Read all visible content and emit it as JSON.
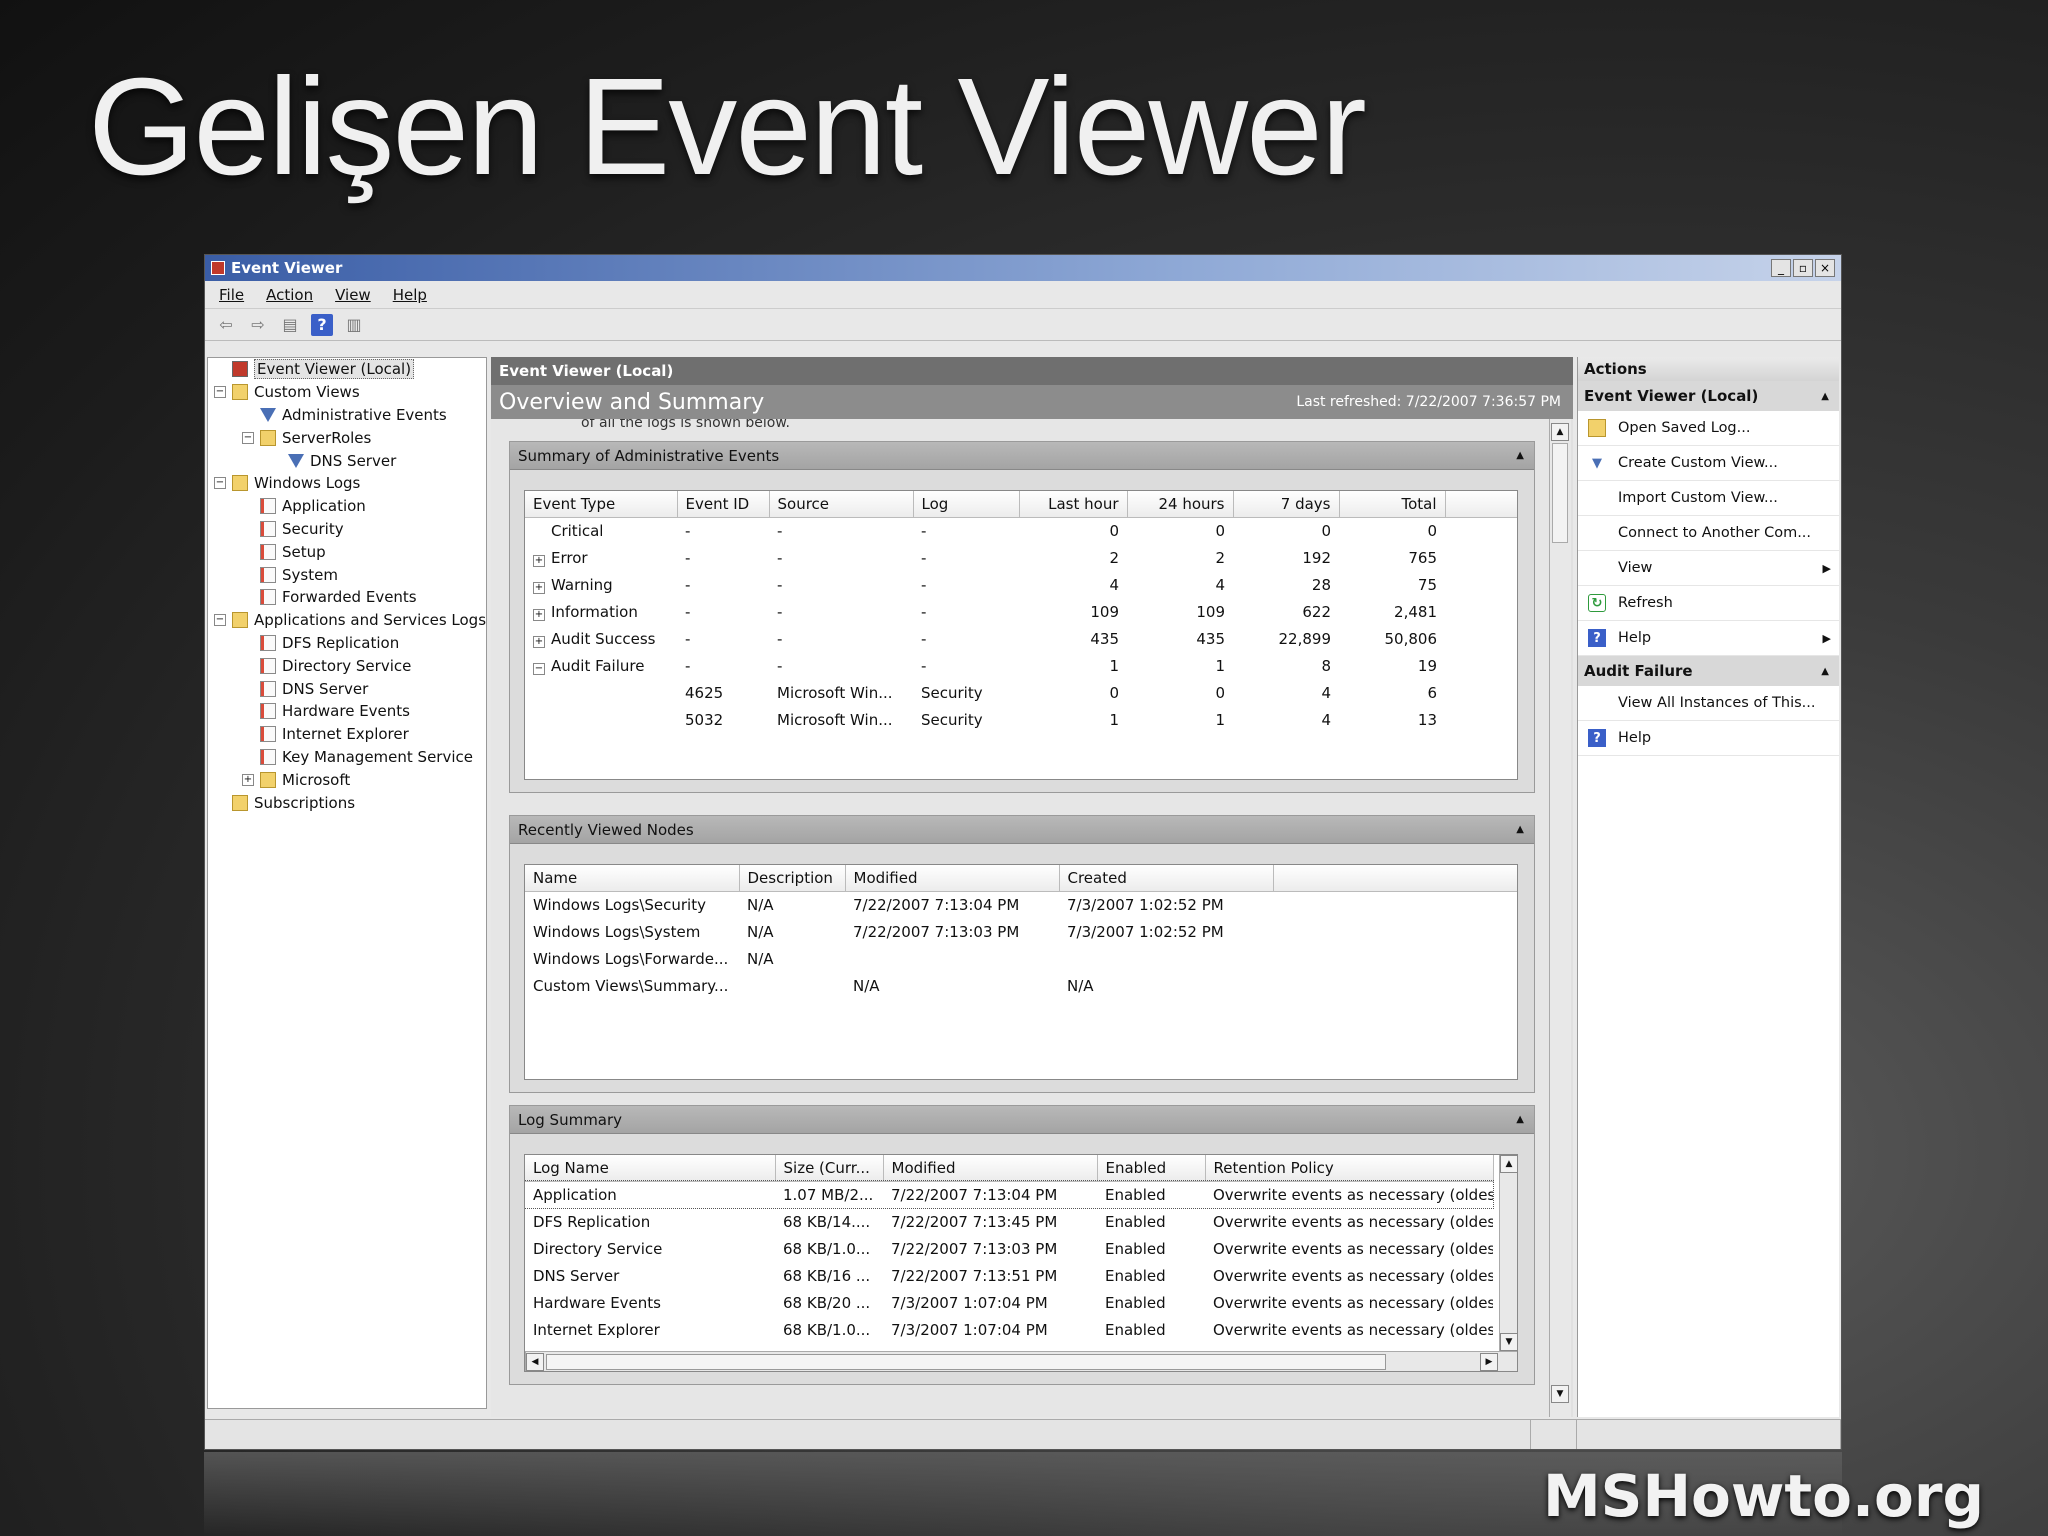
{
  "slide": {
    "title": "Gelişen Event Viewer",
    "brand": "MSHowto.org"
  },
  "window": {
    "title": "Event Viewer",
    "min": "_",
    "max": "▫",
    "close": "×"
  },
  "menu": {
    "file": "File",
    "action": "Action",
    "view": "View",
    "help": "Help"
  },
  "tree": {
    "root": "Event Viewer (Local)",
    "custom_views": "Custom Views",
    "admin_events": "Administrative Events",
    "server_roles": "ServerRoles",
    "dns_server_view": "DNS Server",
    "windows_logs": "Windows Logs",
    "application": "Application",
    "security": "Security",
    "setup": "Setup",
    "system": "System",
    "forwarded": "Forwarded Events",
    "apps_services": "Applications and Services Logs",
    "dfs": "DFS Replication",
    "directory": "Directory Service",
    "dns": "DNS Server",
    "hardware": "Hardware Events",
    "ie": "Internet Explorer",
    "kms": "Key Management Service",
    "microsoft": "Microsoft",
    "subscriptions": "Subscriptions"
  },
  "center": {
    "header": "Event Viewer (Local)",
    "overview_title": "Overview and Summary",
    "last_refreshed": "Last refreshed: 7/22/2007 7:36:57 PM",
    "cut_text": "of all the logs is shown below."
  },
  "admin_summary": {
    "title": "Summary of Administrative Events",
    "columns": [
      "Event Type",
      "Event ID",
      "Source",
      "Log",
      "Last hour",
      "24 hours",
      "7 days",
      "Total"
    ],
    "rows": [
      {
        "exp": "",
        "type": "Critical",
        "id": "-",
        "source": "-",
        "log": "-",
        "hour": "0",
        "day": "0",
        "week": "0",
        "total": "0"
      },
      {
        "exp": "+",
        "type": "Error",
        "id": "-",
        "source": "-",
        "log": "-",
        "hour": "2",
        "day": "2",
        "week": "192",
        "total": "765"
      },
      {
        "exp": "+",
        "type": "Warning",
        "id": "-",
        "source": "-",
        "log": "-",
        "hour": "4",
        "day": "4",
        "week": "28",
        "total": "75"
      },
      {
        "exp": "+",
        "type": "Information",
        "id": "-",
        "source": "-",
        "log": "-",
        "hour": "109",
        "day": "109",
        "week": "622",
        "total": "2,481"
      },
      {
        "exp": "+",
        "type": "Audit Success",
        "id": "-",
        "source": "-",
        "log": "-",
        "hour": "435",
        "day": "435",
        "week": "22,899",
        "total": "50,806"
      },
      {
        "exp": "−",
        "type": "Audit Failure",
        "id": "-",
        "source": "-",
        "log": "-",
        "hour": "1",
        "day": "1",
        "week": "8",
        "total": "19"
      },
      {
        "exp": "",
        "type": "",
        "id": "4625",
        "source": "Microsoft Win...",
        "log": "Security",
        "hour": "0",
        "day": "0",
        "week": "4",
        "total": "6"
      },
      {
        "exp": "",
        "type": "",
        "id": "5032",
        "source": "Microsoft Win...",
        "log": "Security",
        "hour": "1",
        "day": "1",
        "week": "4",
        "total": "13"
      }
    ]
  },
  "recent": {
    "title": "Recently Viewed Nodes",
    "columns": [
      "Name",
      "Description",
      "Modified",
      "Created"
    ],
    "rows": [
      {
        "name": "Windows Logs\\Security",
        "desc": "N/A",
        "modified": "7/22/2007 7:13:04 PM",
        "created": "7/3/2007 1:02:52 PM"
      },
      {
        "name": "Windows Logs\\System",
        "desc": "N/A",
        "modified": "7/22/2007 7:13:03 PM",
        "created": "7/3/2007 1:02:52 PM"
      },
      {
        "name": "Windows Logs\\Forwarde...",
        "desc": "N/A",
        "modified": "",
        "created": ""
      },
      {
        "name": "Custom Views\\Summary...",
        "desc": "",
        "modified": "N/A",
        "created": "N/A"
      }
    ]
  },
  "log_summary": {
    "title": "Log Summary",
    "columns": [
      "Log Name",
      "Size (Curr...",
      "Modified",
      "Enabled",
      "Retention Policy"
    ],
    "rows": [
      {
        "name": "Application",
        "size": "1.07 MB/2...",
        "modified": "7/22/2007 7:13:04 PM",
        "enabled": "Enabled",
        "policy": "Overwrite events as necessary (oldest"
      },
      {
        "name": "DFS Replication",
        "size": "68 KB/14....",
        "modified": "7/22/2007 7:13:45 PM",
        "enabled": "Enabled",
        "policy": "Overwrite events as necessary (oldest"
      },
      {
        "name": "Directory Service",
        "size": "68 KB/1.0...",
        "modified": "7/22/2007 7:13:03 PM",
        "enabled": "Enabled",
        "policy": "Overwrite events as necessary (oldest"
      },
      {
        "name": "DNS Server",
        "size": "68 KB/16 ...",
        "modified": "7/22/2007 7:13:51 PM",
        "enabled": "Enabled",
        "policy": "Overwrite events as necessary (oldest"
      },
      {
        "name": "Hardware Events",
        "size": "68 KB/20 ...",
        "modified": "7/3/2007 1:07:04 PM",
        "enabled": "Enabled",
        "policy": "Overwrite events as necessary (oldest"
      },
      {
        "name": "Internet Explorer",
        "size": "68 KB/1.0...",
        "modified": "7/3/2007 1:07:04 PM",
        "enabled": "Enabled",
        "policy": "Overwrite events as necessary (oldest"
      }
    ]
  },
  "actions": {
    "title": "Actions",
    "group1": "Event Viewer (Local)",
    "open_saved": "Open Saved Log...",
    "create_custom": "Create Custom View...",
    "import_custom": "Import Custom View...",
    "connect": "Connect to Another Com...",
    "view": "View",
    "refresh": "Refresh",
    "help": "Help",
    "group2": "Audit Failure",
    "view_all": "View All Instances of This...",
    "help2": "Help"
  }
}
